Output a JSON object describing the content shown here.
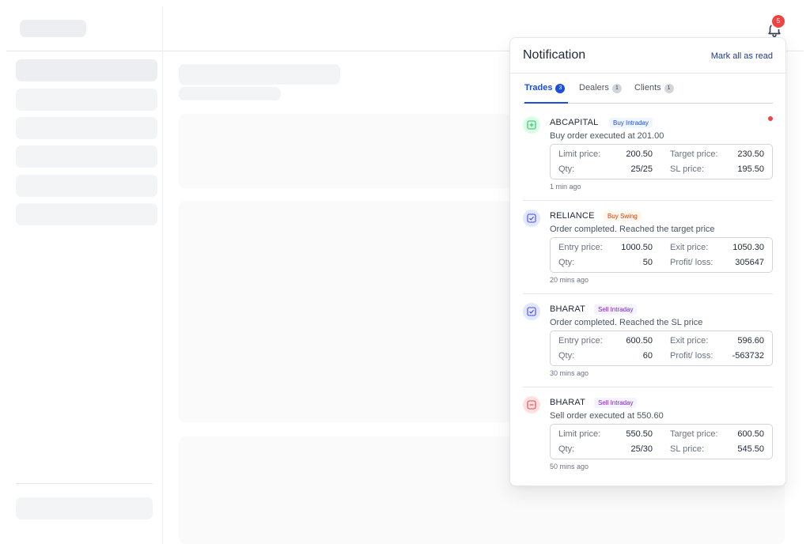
{
  "colors": {
    "accent": "#1d4ed8",
    "badge_red": "#ef4444",
    "skeleton": "#eceef1"
  },
  "header": {
    "bell_icon": "bell-icon",
    "bell_count": "5"
  },
  "notifications": {
    "title": "Notification",
    "mark_all_label": "Mark all as read",
    "tabs": [
      {
        "label": "Trades",
        "count": "3",
        "active": true
      },
      {
        "label": "Dealers",
        "count": "1",
        "active": false
      },
      {
        "label": "Clients",
        "count": "1",
        "active": false
      }
    ],
    "items": [
      {
        "icon": "plus-square-icon",
        "icon_bg": "#dcfce7",
        "icon_color": "#22c55e",
        "symbol": "ABCAPITAL",
        "tag": "Buy Intraday",
        "tag_bg": "#eff6ff",
        "tag_color": "#1d4ed8",
        "message": "Buy order executed at 201.00",
        "unread": true,
        "l1_label": "Limit price:",
        "l1_value": "200.50",
        "r1_label": "Target price:",
        "r1_value": "230.50",
        "l2_label": "Qty:",
        "l2_value": "25/25",
        "r2_label": "SL price:",
        "r2_value": "195.50",
        "time": "1 min ago"
      },
      {
        "icon": "check-square-icon",
        "icon_bg": "#e0e7ff",
        "icon_color": "#4f46e5",
        "symbol": "RELIANCE",
        "tag": "Buy Swing",
        "tag_bg": "#fff7ed",
        "tag_color": "#c2410c",
        "message": "Order completed. Reached the target price",
        "unread": false,
        "l1_label": "Entry price:",
        "l1_value": "1000.50",
        "r1_label": "Exit price:",
        "r1_value": "1050.30",
        "l2_label": "Qty:",
        "l2_value": "50",
        "r2_label": "Profit/ loss:",
        "r2_value": "305647",
        "time": "20 mins ago"
      },
      {
        "icon": "check-square-icon",
        "icon_bg": "#e0e7ff",
        "icon_color": "#4f46e5",
        "symbol": "BHARAT",
        "tag": "Sell Intraday",
        "tag_bg": "#f5f3ff",
        "tag_color": "#7e22ce",
        "message": "Order completed. Reached the SL price",
        "unread": false,
        "l1_label": "Entry price:",
        "l1_value": "600.50",
        "r1_label": "Exit price:",
        "r1_value": "596.60",
        "l2_label": "Qty:",
        "l2_value": "60",
        "r2_label": "Profit/ loss:",
        "r2_value": "-563732",
        "time": "30 mins ago"
      },
      {
        "icon": "minus-square-icon",
        "icon_bg": "#fee2e2",
        "icon_color": "#ef4444",
        "symbol": "BHARAT",
        "tag": "Sell Intraday",
        "tag_bg": "#f5f3ff",
        "tag_color": "#7e22ce",
        "message": "Sell order executed at 550.60",
        "unread": false,
        "l1_label": "Limit price:",
        "l1_value": "550.50",
        "r1_label": "Target price:",
        "r1_value": "600.50",
        "l2_label": "Qty:",
        "l2_value": "25/30",
        "r2_label": "SL price:",
        "r2_value": "545.50",
        "time": "50 mins ago"
      }
    ]
  }
}
